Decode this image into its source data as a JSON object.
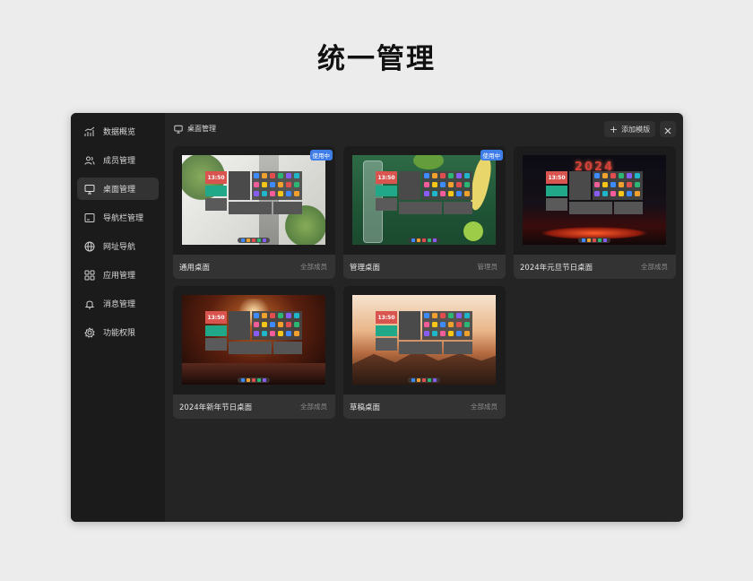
{
  "page": {
    "title": "统一管理"
  },
  "sidebar": {
    "items": [
      {
        "label": "数据概览",
        "icon": "chart-icon",
        "active": false
      },
      {
        "label": "成员管理",
        "icon": "members-icon",
        "active": false
      },
      {
        "label": "桌面管理",
        "icon": "monitor-icon",
        "active": true
      },
      {
        "label": "导航栏管理",
        "icon": "navbar-icon",
        "active": false
      },
      {
        "label": "网址导航",
        "icon": "globe-icon",
        "active": false
      },
      {
        "label": "应用管理",
        "icon": "apps-grid-icon",
        "active": false
      },
      {
        "label": "消息管理",
        "icon": "bell-icon",
        "active": false
      },
      {
        "label": "功能权限",
        "icon": "gear-icon",
        "active": false
      }
    ]
  },
  "main": {
    "header_title": "桌面管理",
    "add_button": "添加模版",
    "cards": [
      {
        "name": "通用桌面",
        "scope": "全部成员",
        "badge": "使用中",
        "theme": "white-plant",
        "clock": "13:50"
      },
      {
        "name": "管理桌面",
        "scope": "管理员",
        "badge": "使用中",
        "theme": "green-bottle",
        "clock": "13:50"
      },
      {
        "name": "2024年元旦节日桌面",
        "scope": "全部成员",
        "badge": "",
        "theme": "new-year-2024",
        "clock": "13:50",
        "overlay_text": "2024"
      },
      {
        "name": "2024年新年节日桌面",
        "scope": "全部成员",
        "badge": "",
        "theme": "concert",
        "clock": "13:50"
      },
      {
        "name": "草稿桌面",
        "scope": "全部成员",
        "badge": "",
        "theme": "desert",
        "clock": "13:50"
      }
    ]
  },
  "colors": {
    "accent": "#3f7ee8",
    "clock_widget": "#d9544f",
    "green_widget": "#21a889"
  }
}
